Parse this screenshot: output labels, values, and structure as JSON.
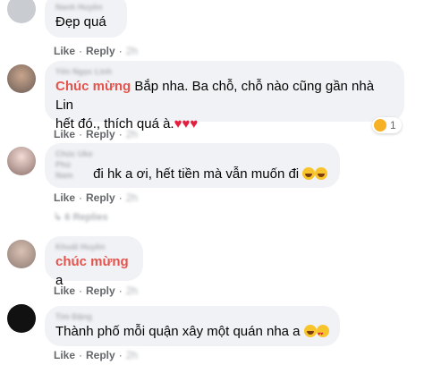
{
  "comments": [
    {
      "author": "Nanh Huyền",
      "text": "Đẹp quá",
      "like": "Like",
      "reply": "Reply",
      "time": "2h"
    },
    {
      "author": "Yến Ngọc Linh",
      "tag": "Chúc mừng",
      "text_line1": " Bắp nha. Ba chỗ, chỗ nào cũng gần nhà Lin",
      "text_line2": "hết đó., thích quá à.",
      "hearts": "♥♥♥",
      "reaction_count": "1",
      "like": "Like",
      "reply": "Reply",
      "time": "2h"
    },
    {
      "author_line1": "Chúc Uke",
      "author_line2": "Phú Nam",
      "text": "đi hk a ơi, hết tiền mà vẫn muốn đi",
      "like": "Like",
      "reply": "Reply",
      "time": "2h",
      "replies": "↳ 6 Replies"
    },
    {
      "author": "Khuất Huyền",
      "tag": "chúc mừng",
      "text": " a",
      "like": "Like",
      "reply": "Reply",
      "time": "2h"
    },
    {
      "author": "Tim Đặng",
      "text": "Thành phố mỗi quận xây một quán nha a",
      "like": "Like",
      "reply": "Reply",
      "time": "2h"
    }
  ]
}
